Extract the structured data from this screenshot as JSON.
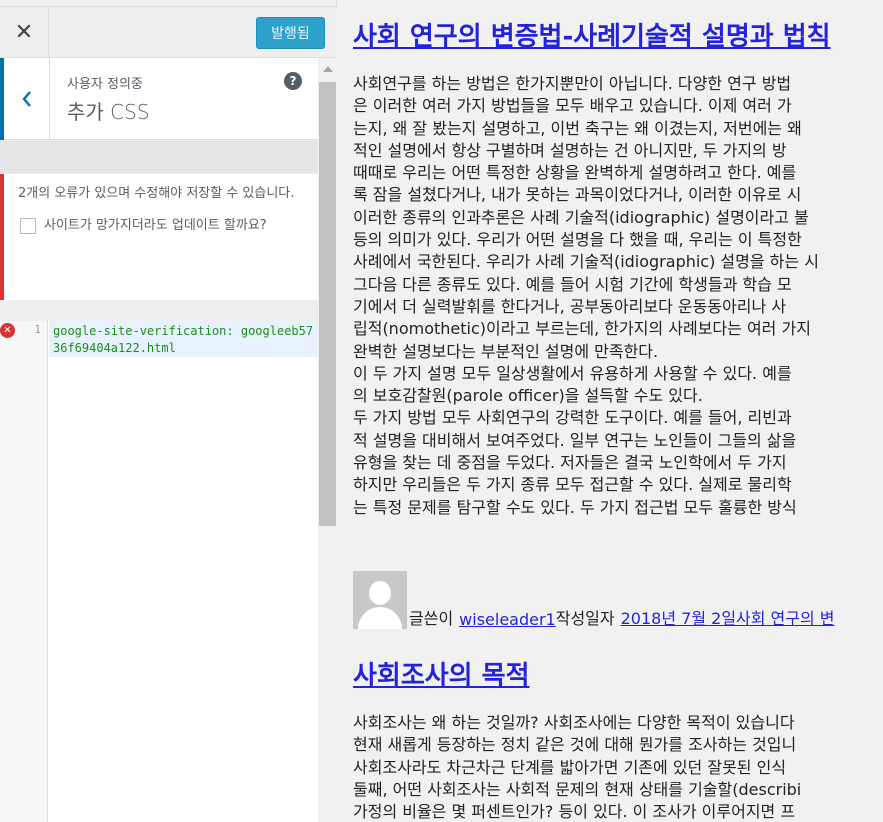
{
  "header": {
    "close_glyph": "✕",
    "publish_label": "발행됨"
  },
  "section": {
    "crumb": "사용자 정의중",
    "title": "추가 CSS",
    "help_glyph": "?"
  },
  "notice": {
    "message": "2개의 오류가 있으며 수정해야 저장할 수 있습니다.",
    "checkbox_label": "사이트가 망가지더라도 업데이트 할까요?"
  },
  "editor": {
    "line_number": "1",
    "code": "google-site-verification: googleeb5736f69404a122.html"
  },
  "preview": {
    "post1_title": "사회 연구의 변증법-사례기술적 설명과 법칙",
    "post1_lines": [
      "사회연구를 하는 방법은 한가지뿐만이 아닙니다. 다양한 연구 방법",
      "은 이러한 여러 가지 방법들을 모두 배우고 있습니다. 이제 여러 가",
      "는지, 왜 잘 봤는지 설명하고, 이번 축구는 왜 이겼는지, 저번에는 왜",
      "적인 설명에서 항상 구별하며 설명하는 건 아니지만, 두 가지의 방",
      "때때로 우리는 어떤 특정한 상황을 완벽하게 설명하려고 한다. 예를",
      "록 잠을 설쳤다거나, 내가 못하는 과목이었다거나, 이러한 이유로 시",
      "이러한 종류의 인과추론은 사례 기술적(idiographic) 설명이라고 불",
      "등의 의미가 있다. 우리가 어떤 설명을 다 했을 때, 우리는 이 특정한",
      "사례에서 국한된다. 우리가 사례 기술적(idiographic) 설명을 하는 시",
      "그다음 다른 종류도 있다. 예를 들어 시험 기간에 학생들과 학습 모",
      "기에서 더 실력발휘를 한다거나, 공부동아리보다 운동동아리나 사",
      "립적(nomothetic)이라고 부르는데, 한가지의 사례보다는 여러 가지",
      "완벽한 설명보다는 부분적인 설명에 만족한다.",
      "이 두 가지 설명 모두 일상생활에서 유용하게 사용할 수 있다. 예를",
      "의 보호감찰원(parole officer)을 설득할 수도 있다.",
      "두 가지 방법 모두 사회연구의 강력한 도구이다. 예를 들어, 리빈과",
      "적 설명을 대비해서 보여주었다. 일부 연구는 노인들이 그들의 삶을",
      "유형을 찾는 데 중점을 두었다. 저자들은 결국 노인학에서 두 가지",
      "하지만 우리들은 두 가지 종류 모두 접근할 수 있다. 실제로 물리학",
      "는 특정 문제를 탐구할 수도 있다. 두 가지 접근법 모두 훌륭한 방식"
    ],
    "meta_by": "글쓴이",
    "meta_author": "wiseleader1",
    "meta_written": "작성일자",
    "meta_date_link": "2018년 7월 2일사회 연구의 변",
    "post2_title": "사회조사의 목적",
    "post2_lines": [
      "사회조사는 왜 하는 것일까? 사회조사에는 다양한 목적이 있습니다",
      "현재 새롭게 등장하는 정치 같은 것에 대해 뭔가를 조사하는 것입니",
      "사회조사라도 차근차근 단계를 밟아가면 기존에 있던 잘못된 인식",
      "둘째, 어떤 사회조사는 사회적 문제의 현재 상태를 기술할(describi",
      "가정의 비율은 몇 퍼센트인가? 등이 있다. 이 조사가 이루어지면 프"
    ]
  }
}
